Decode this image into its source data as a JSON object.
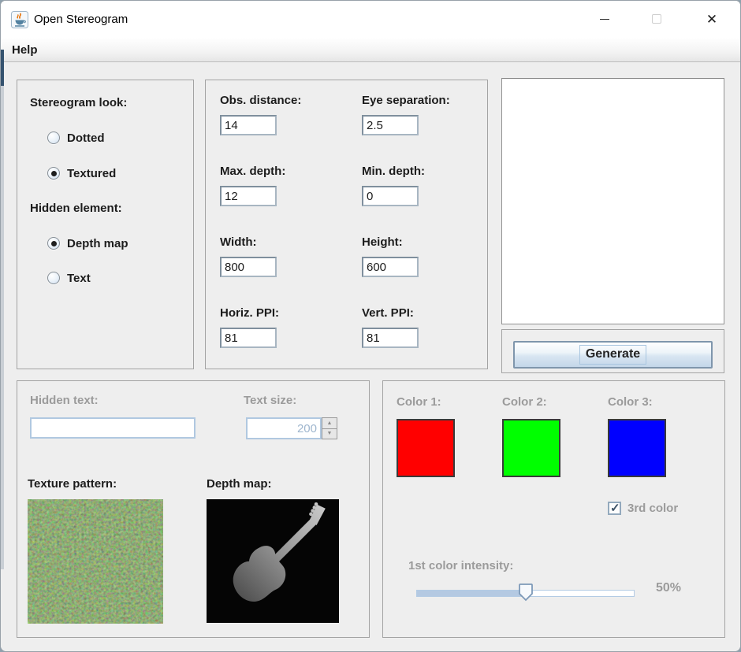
{
  "window": {
    "title": "Open Stereogram",
    "icons": {
      "minimize": "minimize-icon",
      "maximize": "maximize-icon",
      "close_glyph": "✕"
    }
  },
  "menu": {
    "help": "Help"
  },
  "look_panel": {
    "title": "Stereogram look:",
    "options": [
      {
        "label": "Dotted",
        "selected": false
      },
      {
        "label": "Textured",
        "selected": true
      }
    ],
    "hidden_title": "Hidden element:",
    "hidden_options": [
      {
        "label": "Depth map",
        "selected": true
      },
      {
        "label": "Text",
        "selected": false
      }
    ]
  },
  "params_panel": {
    "fields": [
      {
        "label": "Obs. distance:",
        "value": "14"
      },
      {
        "label": "Eye separation:",
        "value": "2.5"
      },
      {
        "label": "Max. depth:",
        "value": "12"
      },
      {
        "label": "Min. depth:",
        "value": "0"
      },
      {
        "label": "Width:",
        "value": "800"
      },
      {
        "label": "Height:",
        "value": "600"
      },
      {
        "label": "Horiz. PPI:",
        "value": "81"
      },
      {
        "label": "Vert. PPI:",
        "value": "81"
      }
    ]
  },
  "preview_panel": {
    "generate_label": "Generate"
  },
  "hidden_panel": {
    "hidden_text_label": "Hidden text:",
    "hidden_text_value": "",
    "text_size_label": "Text size:",
    "text_size_value": "200",
    "spinner_up_glyph": "▲",
    "spinner_down_glyph": "▼",
    "texture_label": "Texture pattern:",
    "depth_label": "Depth map:"
  },
  "color_panel": {
    "colors": [
      {
        "label": "Color 1:",
        "hex": "#ff0000"
      },
      {
        "label": "Color 2:",
        "hex": "#00ff00"
      },
      {
        "label": "Color 3:",
        "hex": "#0000ff"
      }
    ],
    "third_color_label": "3rd color",
    "third_color_checked": true,
    "check_glyph": "✓",
    "intensity_label": "1st color intensity:",
    "intensity_value": "50%",
    "slider_percent": 50
  },
  "theme": {
    "accent_fill": "#b4c9e2",
    "disabled_text": "#9b9b9b",
    "label_text": "#1c1c1c",
    "panel_bg": "#eeeeee"
  }
}
